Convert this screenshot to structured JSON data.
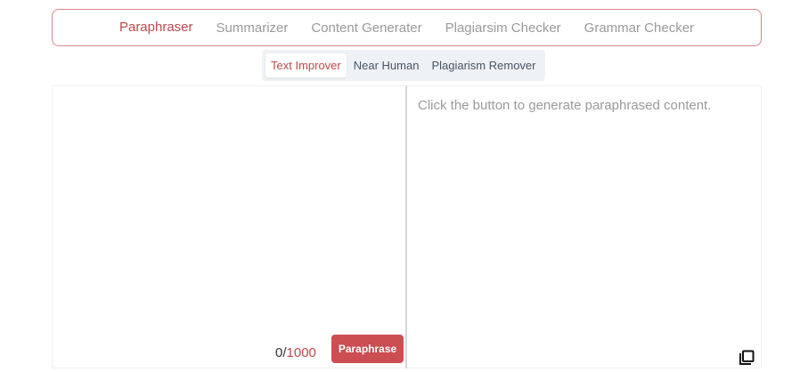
{
  "tabs": [
    {
      "label": "Paraphraser",
      "active": true
    },
    {
      "label": "Summarizer",
      "active": false
    },
    {
      "label": "Content Generater",
      "active": false
    },
    {
      "label": "Plagiarsim Checker",
      "active": false
    },
    {
      "label": "Grammar Checker",
      "active": false
    }
  ],
  "subtabs": [
    {
      "label": "Text Improver",
      "active": true
    },
    {
      "label": "Near Human",
      "active": false
    },
    {
      "label": "Plagiarism Remover",
      "active": false
    }
  ],
  "input": {
    "value": "",
    "count": "0/",
    "max": "1000"
  },
  "paraphrase_button": "Paraphrase",
  "output": {
    "placeholder": "Click the button to generate paraphrased content."
  },
  "icons": {
    "copy": "copy-icon"
  },
  "colors": {
    "accent": "#c0474c",
    "button": "#cc4d52",
    "muted": "#9a9a9a"
  }
}
